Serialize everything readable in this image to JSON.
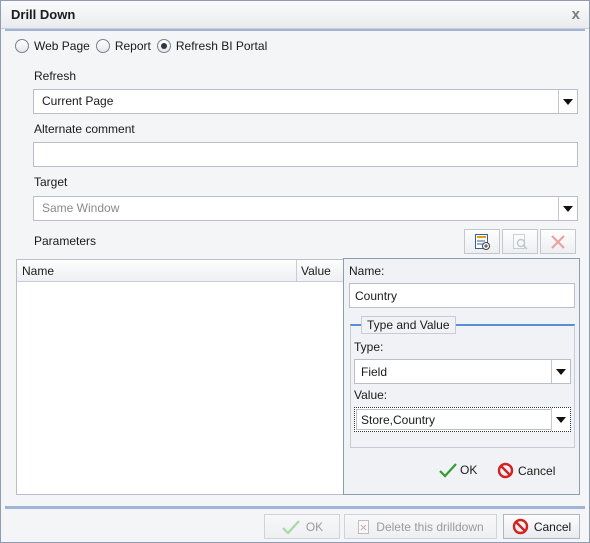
{
  "window": {
    "title": "Drill Down",
    "close_glyph": "x"
  },
  "link_type": {
    "options": [
      {
        "label": "Web Page",
        "checked": false
      },
      {
        "label": "Report",
        "checked": false
      },
      {
        "label": "Refresh BI Portal",
        "checked": true
      }
    ]
  },
  "refresh": {
    "label": "Refresh",
    "value": "Current Page"
  },
  "alt_comment": {
    "label": "Alternate comment",
    "value": ""
  },
  "target": {
    "label": "Target",
    "value": "Same Window"
  },
  "parameters": {
    "label": "Parameters",
    "toolbar": {
      "add_icon": "add-parameter-icon",
      "edit_icon": "edit-parameter-icon",
      "delete_icon": "delete-parameter-icon"
    },
    "columns": [
      "Name",
      "Value"
    ],
    "rows": []
  },
  "param_editor": {
    "name_label": "Name:",
    "name_value": "Country",
    "group_title": "Type and Value",
    "type_label": "Type:",
    "type_value": "Field",
    "value_label": "Value:",
    "value_value": "Store,Country",
    "ok_label": "OK",
    "cancel_label": "Cancel"
  },
  "footer": {
    "ok_label": "OK",
    "delete_label": "Delete this drilldown",
    "cancel_label": "Cancel"
  },
  "colors": {
    "accent_line": "#9fb4d6",
    "group_line": "#5a8bd6",
    "ok_green": "#2f9e2f",
    "cancel_red": "#d42222"
  }
}
